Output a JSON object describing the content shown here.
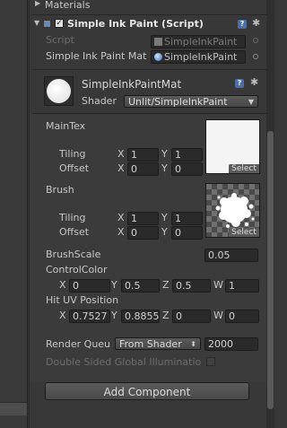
{
  "materials_foldout": {
    "label": "Materials"
  },
  "component": {
    "title": "Simple Ink Paint (Script)",
    "enabled": true,
    "script_label": "Script",
    "script_value": "SimpleInkPaint",
    "mat_label": "Simple Ink Paint Mat",
    "mat_value": "SimpleInkPaint"
  },
  "material": {
    "name": "SimpleInkPaintMat",
    "shader_label": "Shader",
    "shader_value": "Unlit/SimpleInkPaint"
  },
  "main_tex": {
    "label": "MainTex",
    "tiling_label": "Tiling",
    "offset_label": "Offset",
    "tiling_x": "1",
    "tiling_y": "1",
    "offset_x": "0",
    "offset_y": "0",
    "select_label": "Select"
  },
  "brush": {
    "label": "Brush",
    "tiling_label": "Tiling",
    "offset_label": "Offset",
    "tiling_x": "1",
    "tiling_y": "1",
    "offset_x": "0",
    "offset_y": "0",
    "select_label": "Select"
  },
  "brush_scale": {
    "label": "BrushScale",
    "value": "0.05"
  },
  "control_color": {
    "label": "ControlColor",
    "x": "0",
    "y": "0.5",
    "z": "0.5",
    "w": "1"
  },
  "hit_uv": {
    "label": "Hit UV Position",
    "x": "0.7527",
    "y": "0.8855",
    "z": "0",
    "w": "0"
  },
  "axis": {
    "x": "X",
    "y": "Y",
    "z": "Z",
    "w": "W"
  },
  "render_queue": {
    "label": "Render Queu",
    "dropdown": "From Shader",
    "value": "2000"
  },
  "double_sided": {
    "label": "Double Sided Global Illuminatio",
    "checked": false
  },
  "add_component": {
    "label": "Add Component"
  },
  "colors": {
    "panel": "#383838",
    "field": "#2a2a2a",
    "accent": "#4a6fa8",
    "text": "#c8c8c8"
  }
}
